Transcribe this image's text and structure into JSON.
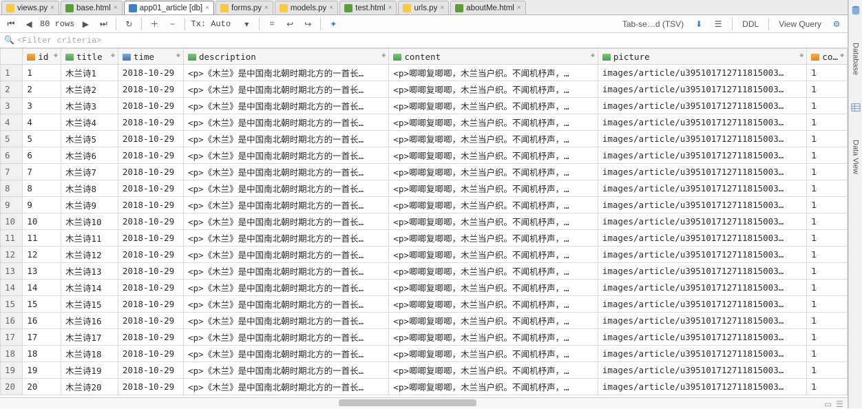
{
  "tabs": [
    {
      "label": "views.py",
      "kind": "py",
      "close": true
    },
    {
      "label": "base.html",
      "kind": "html",
      "close": true
    },
    {
      "label": "app01_article [db]",
      "kind": "db",
      "close": true,
      "active": true
    },
    {
      "label": "forms.py",
      "kind": "py",
      "close": true
    },
    {
      "label": "models.py",
      "kind": "py",
      "close": true
    },
    {
      "label": "test.html",
      "kind": "html",
      "close": true
    },
    {
      "label": "urls.py",
      "kind": "py",
      "close": true
    },
    {
      "label": "aboutMe.html",
      "kind": "html",
      "close": true
    }
  ],
  "toolbar": {
    "row_count": "80 rows",
    "tx": "Tx: Auto ",
    "format": "Tab-se…d (TSV)",
    "ddl": "DDL",
    "view_query": "View Query"
  },
  "filter_placeholder": "<Filter criteria>",
  "columns": [
    {
      "key": "id",
      "label": "id",
      "icon": "num",
      "width": "c-id"
    },
    {
      "key": "title",
      "label": "title",
      "icon": "txt",
      "width": "c-title"
    },
    {
      "key": "time",
      "label": "time",
      "icon": "date",
      "width": "c-time"
    },
    {
      "key": "description",
      "label": "description",
      "icon": "txt",
      "width": "c-desc"
    },
    {
      "key": "content",
      "label": "content",
      "icon": "txt",
      "width": "c-content"
    },
    {
      "key": "picture",
      "label": "picture",
      "icon": "txt",
      "width": "c-pic"
    },
    {
      "key": "comme",
      "label": "comme",
      "icon": "num",
      "width": "c-comme"
    }
  ],
  "row_template": {
    "time": "2018-10-29",
    "description": "<p>《木兰》是中国南北朝时期北方的一首长…",
    "content": "<p>唧唧复唧唧，木兰当户织。不闻机杼声，…",
    "picture": "images/article/u395101712711815003…",
    "comme": "1"
  },
  "rows": [
    {
      "n": 1,
      "id": "1",
      "title": "木兰诗1"
    },
    {
      "n": 2,
      "id": "2",
      "title": "木兰诗2"
    },
    {
      "n": 3,
      "id": "3",
      "title": "木兰诗3"
    },
    {
      "n": 4,
      "id": "4",
      "title": "木兰诗4"
    },
    {
      "n": 5,
      "id": "5",
      "title": "木兰诗5"
    },
    {
      "n": 6,
      "id": "6",
      "title": "木兰诗6"
    },
    {
      "n": 7,
      "id": "7",
      "title": "木兰诗7"
    },
    {
      "n": 8,
      "id": "8",
      "title": "木兰诗8"
    },
    {
      "n": 9,
      "id": "9",
      "title": "木兰诗9"
    },
    {
      "n": 10,
      "id": "10",
      "title": "木兰诗10"
    },
    {
      "n": 11,
      "id": "11",
      "title": "木兰诗11"
    },
    {
      "n": 12,
      "id": "12",
      "title": "木兰诗12"
    },
    {
      "n": 13,
      "id": "13",
      "title": "木兰诗13"
    },
    {
      "n": 14,
      "id": "14",
      "title": "木兰诗14"
    },
    {
      "n": 15,
      "id": "15",
      "title": "木兰诗15"
    },
    {
      "n": 16,
      "id": "16",
      "title": "木兰诗16"
    },
    {
      "n": 17,
      "id": "17",
      "title": "木兰诗17"
    },
    {
      "n": 18,
      "id": "18",
      "title": "木兰诗18"
    },
    {
      "n": 19,
      "id": "19",
      "title": "木兰诗19"
    },
    {
      "n": 20,
      "id": "20",
      "title": "木兰诗20"
    }
  ],
  "side": {
    "label1": "Database",
    "label2": "Data View"
  }
}
